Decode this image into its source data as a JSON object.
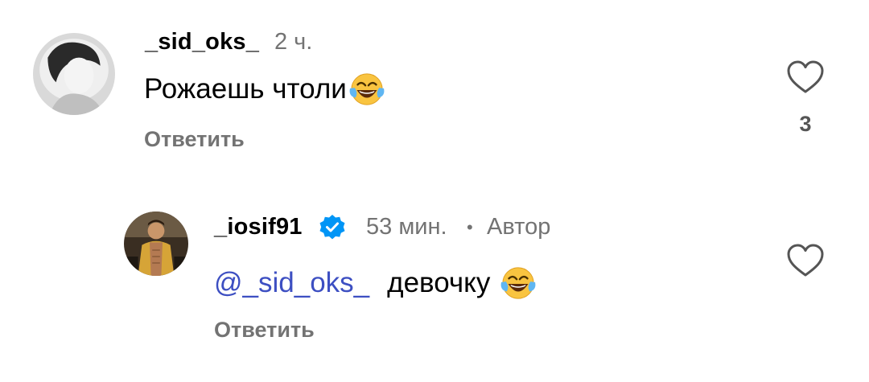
{
  "comments": [
    {
      "username": "_sid_oks_",
      "time": "2 ч.",
      "text": "Рожаешь чтоли",
      "emoji_icon": "face-with-tears-of-joy-icon",
      "reply_label": "Ответить",
      "like_count": "3"
    },
    {
      "username": "_iosif91",
      "verified": true,
      "time": "53 мин.",
      "author_label": "Автор",
      "mention": "@_sid_oks_",
      "text": "девочку",
      "emoji_icon": "face-with-tears-of-joy-icon",
      "reply_label": "Ответить"
    }
  ],
  "colors": {
    "meta_gray": "#737373",
    "mention_blue": "#3d4fc2",
    "verified_blue": "#0095f6"
  }
}
